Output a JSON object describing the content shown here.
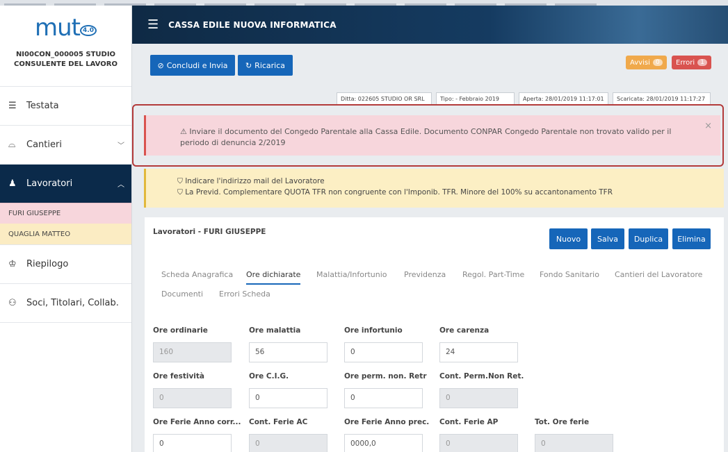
{
  "sidebar": {
    "logo_text": "mut",
    "logo_version": "4.0",
    "company": "NI00CON_000005 STUDIO CONSULENTE DEL LAVORO",
    "items": [
      {
        "label": "Testata",
        "icon": "list-icon"
      },
      {
        "label": "Cantieri",
        "icon": "hardhat-icon"
      },
      {
        "label": "Lavoratori",
        "icon": "worker-icon"
      },
      {
        "label": "Riepilogo",
        "icon": "summary-icon"
      },
      {
        "label": "Soci, Titolari, Collab.",
        "icon": "people-icon"
      }
    ],
    "workers": [
      "FURI GIUSEPPE",
      "QUAGLIA MATTEO"
    ]
  },
  "header": {
    "title": "CASSA EDILE NUOVA INFORMATICA"
  },
  "toolbar": {
    "concludi_label": "Concludi e Invia",
    "ricarica_label": "Ricarica",
    "avvisi_label": "Avvisi",
    "avvisi_count": "0",
    "errori_label": "Errori",
    "errori_count": "1"
  },
  "info": {
    "ditta": "Ditta: 022605 STUDIO OR SRL",
    "tipo": "Tipo: - Febbraio 2019",
    "aperta": "Aperta: 28/01/2019 11:17:01",
    "scaricata": "Scaricata: 28/01/2019 11:17:27"
  },
  "alerts": {
    "error": "⚠ Inviare il documento del Congedo Parentale alla Cassa Edile. Documento CONPAR Congedo Parentale non trovato valido per il periodo di denuncia 2/2019",
    "warnings": [
      "⛉ Indicare l'indirizzo mail del Lavoratore",
      "⛉ La Previd. Complementare QUOTA TFR non congruente con l'Imponib. TFR. Minore del 100% su accantonamento TFR"
    ]
  },
  "panel": {
    "title": "Lavoratori - FURI GIUSEPPE",
    "buttons": {
      "nuovo": "Nuovo",
      "salva": "Salva",
      "duplica": "Duplica",
      "elimina": "Elimina"
    },
    "tabs": [
      "Scheda Anagrafica",
      "Ore dichiarate",
      "Malattia/Infortunio",
      "Previdenza",
      "Regol. Part-Time",
      "Fondo Sanitario",
      "Cantieri del Lavoratore",
      "Documenti",
      "Errori Scheda"
    ],
    "active_tab": "Ore dichiarate",
    "fields": [
      {
        "label": "Ore ordinarie",
        "value": "160"
      },
      {
        "label": "Ore malattia",
        "value": "56"
      },
      {
        "label": "Ore infortunio",
        "value": "0"
      },
      {
        "label": "Ore carenza",
        "value": "24"
      },
      {
        "label": "Ore festività",
        "value": "0"
      },
      {
        "label": "Ore C.I.G.",
        "value": "0"
      },
      {
        "label": "Ore perm. non. Retr",
        "value": "0"
      },
      {
        "label": "Cont. Perm.Non Ret.",
        "value": "0"
      },
      {
        "label": "Ore Ferie Anno corr...",
        "value": "0"
      },
      {
        "label": "Cont. Ferie AC",
        "value": "0"
      },
      {
        "label": "Ore Ferie Anno prec.",
        "value": "0000,0"
      },
      {
        "label": "Cont. Ferie AP",
        "value": "0"
      },
      {
        "label": "Tot. Ore ferie",
        "value": "0"
      }
    ]
  },
  "colors": {
    "primary": "#1666b9",
    "sidebar_active": "#0b2a4a",
    "error": "#d9534f",
    "warning": "#f0a94b"
  }
}
